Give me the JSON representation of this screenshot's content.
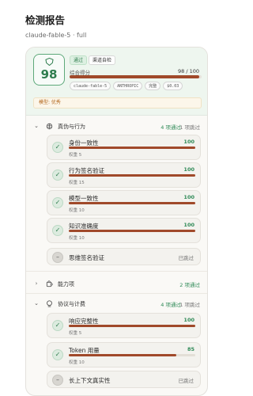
{
  "page": {
    "title": "检测报告",
    "subtitle": "claude-fable-5 · full"
  },
  "summary": {
    "score": "98",
    "status_chip": "通过",
    "source_chip": "渠道自检",
    "score_label": "综合得分",
    "score_value": "98 / 100",
    "score_fraction": 0.98,
    "tags": [
      "claude-fable-5",
      "ANTHROPIC",
      "完整",
      "$0.03"
    ],
    "note": "模型: 优秀"
  },
  "groups": [
    {
      "title": "真伪与行为",
      "passed": "4 项通过",
      "skipped": "1 项跳过",
      "expanded": true,
      "items": [
        {
          "name": "身份一致性",
          "score": "100",
          "fraction": 1.0,
          "weight": "权重 5"
        },
        {
          "name": "行为签名验证",
          "score": "100",
          "fraction": 1.0,
          "weight": "权重 15"
        },
        {
          "name": "模型一致性",
          "score": "100",
          "fraction": 1.0,
          "weight": "权重 10"
        },
        {
          "name": "知识准确度",
          "score": "100",
          "fraction": 1.0,
          "weight": "权重 10"
        },
        {
          "name": "思维签名验证",
          "status": "已跳过"
        }
      ]
    },
    {
      "title": "能力项",
      "passed": "2 项通过",
      "expanded": false
    },
    {
      "title": "协议与计费",
      "passed": "4 项通过",
      "skipped": "1 项跳过",
      "expanded": true,
      "items": [
        {
          "name": "响应完整性",
          "score": "100",
          "fraction": 1.0,
          "weight": "权重 5"
        },
        {
          "name": "Token 用量",
          "score": "85",
          "fraction": 0.85,
          "weight": "权重 10"
        },
        {
          "name": "长上下文真实性",
          "status": "已跳过"
        }
      ]
    }
  ],
  "colors": {
    "accent_green": "#2f8a57",
    "bar_fill": "#a0492a",
    "note_text": "#b4681f"
  },
  "icons": {
    "group_1": "brain-icon",
    "group_2": "puzzle-icon",
    "group_3": "coin-icon",
    "score": "shield-icon"
  }
}
